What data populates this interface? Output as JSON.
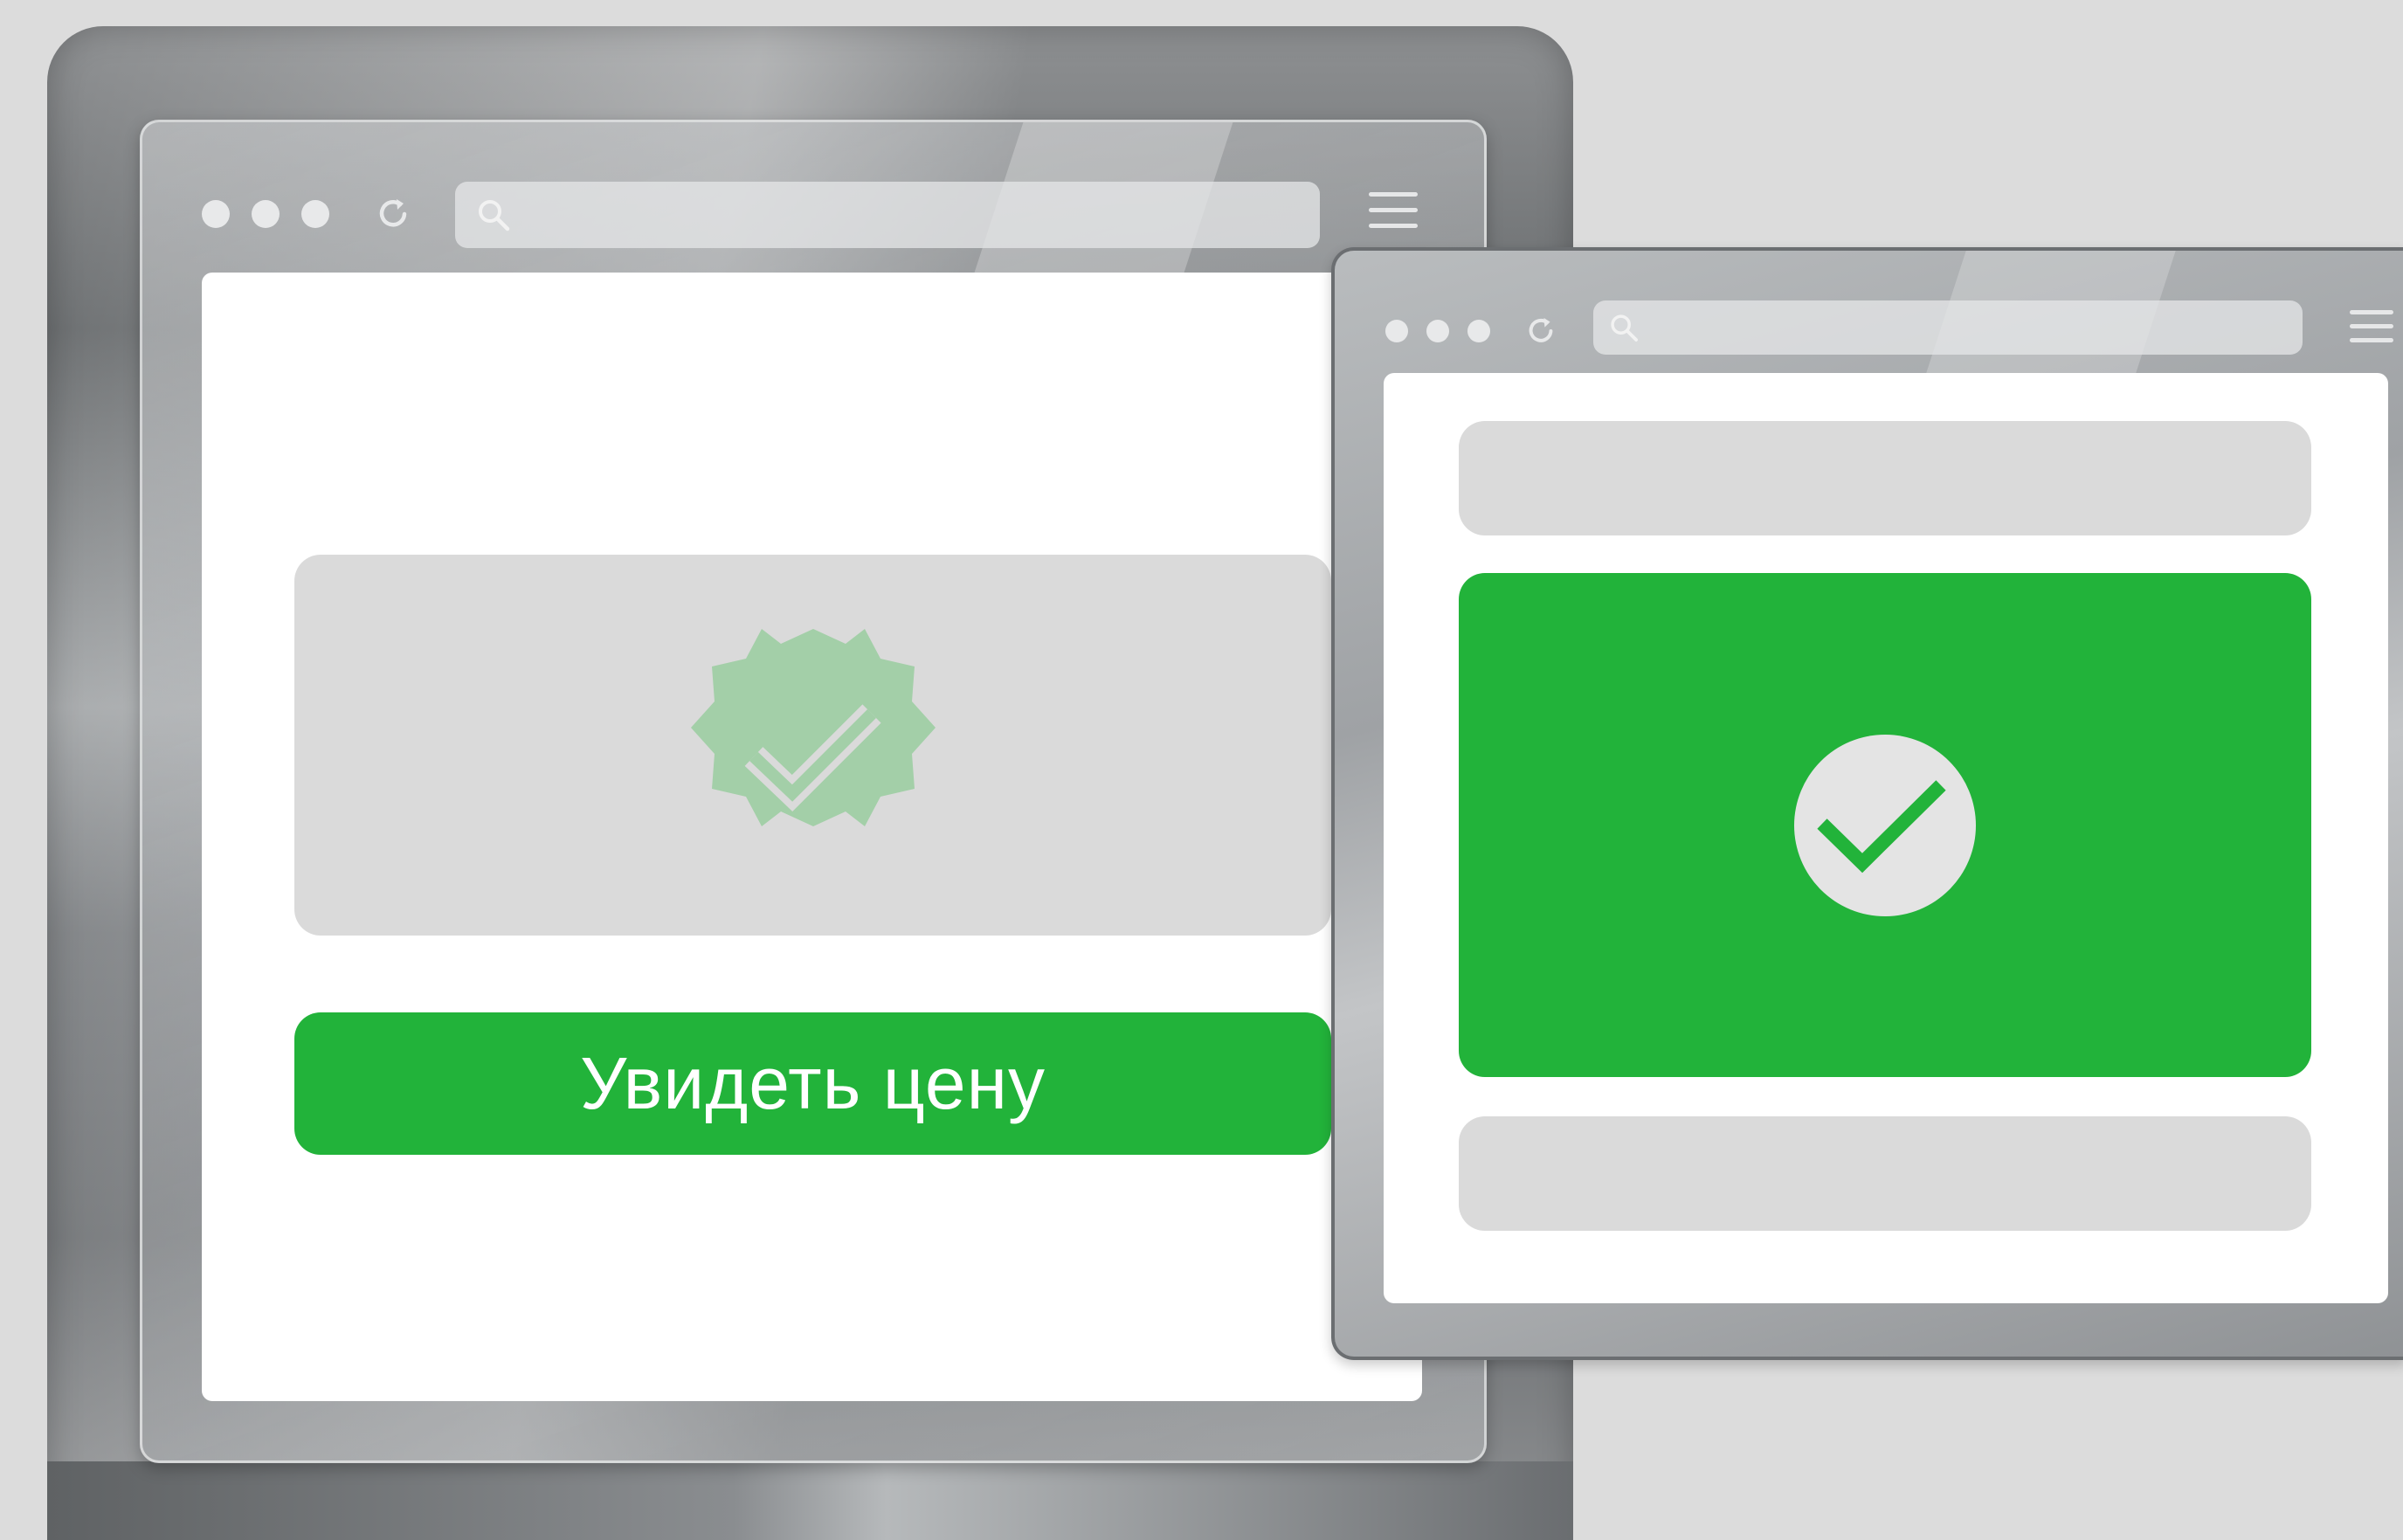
{
  "background_color": "#dcdcdc",
  "accent_color": "#22b33a",
  "left_window": {
    "toolbar": {
      "dots": [
        "dot",
        "dot",
        "dot"
      ],
      "icons": {
        "reload": "reload-icon",
        "search": "search-icon",
        "menu": "hamburger-menu-icon"
      },
      "address_value": ""
    },
    "page": {
      "image_icon": "verified-badge-icon",
      "cta_label": "Увидеть цену"
    }
  },
  "right_window": {
    "toolbar": {
      "icons": {
        "reload": "reload-icon",
        "search": "search-icon",
        "menu": "hamburger-menu-icon"
      },
      "address_value": ""
    },
    "page": {
      "success_icon": "check-circle-icon"
    }
  }
}
